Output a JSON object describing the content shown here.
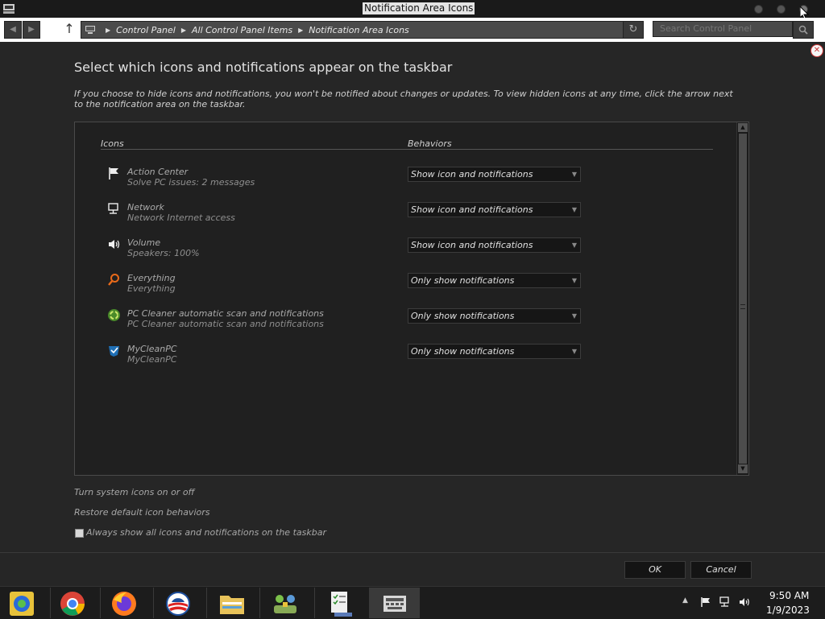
{
  "window": {
    "title": "Notification Area Icons"
  },
  "address_bar": {
    "back_glyph": "◀",
    "forward_glyph": "▶",
    "up_glyph": "↑",
    "breadcrumb": [
      "Control Panel",
      "All Control Panel Items",
      "Notification Area Icons"
    ],
    "refresh_glyph": "↻",
    "search_placeholder": "Search Control Panel"
  },
  "content": {
    "title": "Select which icons and notifications appear on the taskbar",
    "description": "If you choose to hide icons and notifications, you won't be notified about changes or updates. To view hidden icons at any time, click the arrow next to the notification area on the taskbar.",
    "columns": {
      "icons": "Icons",
      "behaviors": "Behaviors"
    },
    "rows": [
      {
        "name": "Action Center",
        "desc": "Solve PC issues: 2 messages",
        "behavior": "Show icon and notifications",
        "icon": "flag-icon"
      },
      {
        "name": "Network",
        "desc": "Network Internet access",
        "behavior": "Show icon and notifications",
        "icon": "network-icon"
      },
      {
        "name": "Volume",
        "desc": "Speakers: 100%",
        "behavior": "Show icon and notifications",
        "icon": "speaker-icon"
      },
      {
        "name": "Everything",
        "desc": "Everything",
        "behavior": "Only show notifications",
        "icon": "magnifier-icon"
      },
      {
        "name": "PC Cleaner automatic scan and notifications",
        "desc": "PC Cleaner automatic scan and notifications",
        "behavior": "Only show notifications",
        "icon": "pc-cleaner-icon"
      },
      {
        "name": "MyCleanPC",
        "desc": "MyCleanPC",
        "behavior": "Only show notifications",
        "icon": "mycleanpc-icon"
      }
    ],
    "links": {
      "system_icons": "Turn system icons on or off",
      "restore": "Restore default icon behaviors"
    },
    "always_show": {
      "label": "Always show all icons and notifications on the taskbar",
      "checked": false
    },
    "buttons": {
      "ok": "OK",
      "cancel": "Cancel"
    }
  },
  "taskbar": {
    "apps": [
      "control-panel-icon",
      "chrome-icon",
      "firefox-icon",
      "obama-logo-icon",
      "file-explorer-icon",
      "network-share-icon",
      "task-list-icon",
      "keyboard-icon"
    ],
    "tray_arrow": "▲",
    "clock_time": "9:50 AM",
    "clock_date": "1/9/2023"
  }
}
